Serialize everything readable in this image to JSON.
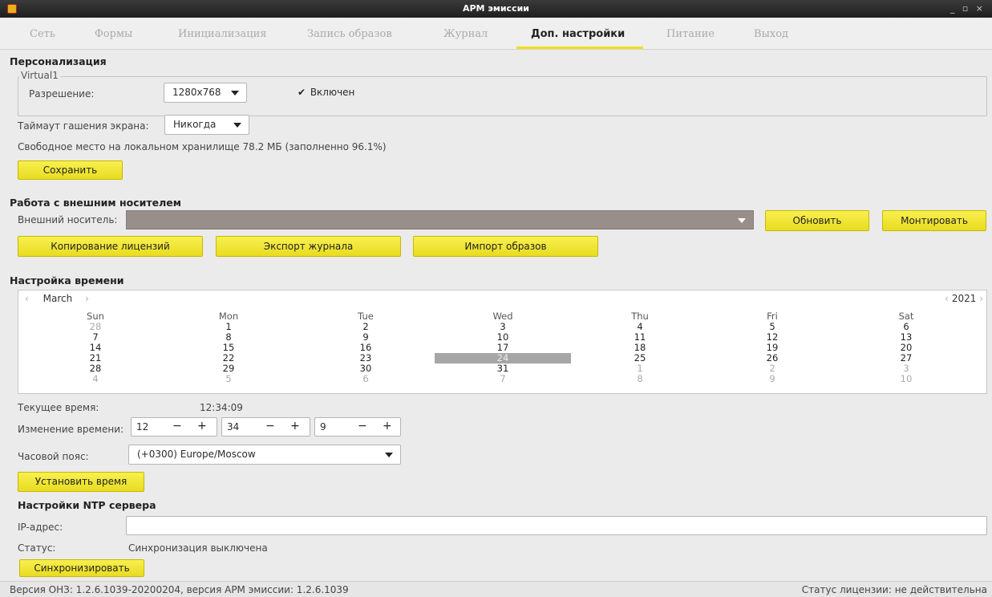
{
  "window": {
    "title": "АРМ эмиссии",
    "controls": "_ ▫ ×"
  },
  "tabs": [
    {
      "label": "Сеть"
    },
    {
      "label": "Формы"
    },
    {
      "label": "Инициализация"
    },
    {
      "label": "Запись образов"
    },
    {
      "label": "Журнал"
    },
    {
      "label": "Доп. настройки"
    },
    {
      "label": "Питание"
    },
    {
      "label": "Выход"
    }
  ],
  "personalization": {
    "heading": "Персонализация",
    "group_title": "Virtual1",
    "resolution_label": "Разрешение:",
    "resolution_value": "1280x768",
    "enabled_label": "Включен",
    "enabled_checked": true,
    "timeout_label": "Таймаут гашения экрана:",
    "timeout_value": "Никогда",
    "storage_text": "Свободное место на локальном хранилище 78.2 МБ (заполненно 96.1%)",
    "save_label": "Сохранить"
  },
  "external_media": {
    "heading": "Работа с внешним носителем",
    "media_label": "Внешний носитель:",
    "media_value": "",
    "refresh_label": "Обновить",
    "mount_label": "Монтировать",
    "copy_licenses_label": "Копирование лицензий",
    "export_log_label": "Экспорт журнала",
    "import_images_label": "Импорт образов"
  },
  "time_settings": {
    "heading": "Настройка времени",
    "calendar": {
      "month": "March",
      "year": "2021",
      "prev_month": "‹",
      "next_month": "›",
      "prev_year": "‹",
      "next_year": "›",
      "weekdays": [
        "Sun",
        "Mon",
        "Tue",
        "Wed",
        "Thu",
        "Fri",
        "Sat"
      ],
      "weeks": [
        [
          {
            "d": "28",
            "o": true
          },
          {
            "d": "1"
          },
          {
            "d": "2"
          },
          {
            "d": "3"
          },
          {
            "d": "4"
          },
          {
            "d": "5"
          },
          {
            "d": "6"
          }
        ],
        [
          {
            "d": "7"
          },
          {
            "d": "8"
          },
          {
            "d": "9"
          },
          {
            "d": "10"
          },
          {
            "d": "11"
          },
          {
            "d": "12"
          },
          {
            "d": "13"
          }
        ],
        [
          {
            "d": "14"
          },
          {
            "d": "15"
          },
          {
            "d": "16"
          },
          {
            "d": "17"
          },
          {
            "d": "18"
          },
          {
            "d": "19"
          },
          {
            "d": "20"
          }
        ],
        [
          {
            "d": "21"
          },
          {
            "d": "22"
          },
          {
            "d": "23"
          },
          {
            "d": "24",
            "s": true
          },
          {
            "d": "25"
          },
          {
            "d": "26"
          },
          {
            "d": "27"
          }
        ],
        [
          {
            "d": "28"
          },
          {
            "d": "29"
          },
          {
            "d": "30"
          },
          {
            "d": "31"
          },
          {
            "d": "1",
            "o": true
          },
          {
            "d": "2",
            "o": true
          },
          {
            "d": "3",
            "o": true
          }
        ],
        [
          {
            "d": "4",
            "o": true
          },
          {
            "d": "5",
            "o": true
          },
          {
            "d": "6",
            "o": true
          },
          {
            "d": "7",
            "o": true
          },
          {
            "d": "8",
            "o": true
          },
          {
            "d": "9",
            "o": true
          },
          {
            "d": "10",
            "o": true
          }
        ]
      ]
    },
    "current_time_label": "Текущее время:",
    "current_time_value": "12:34:09",
    "change_time_label": "Изменение времени:",
    "hours": "12",
    "minutes": "34",
    "seconds": "9",
    "minus": "−",
    "plus": "+",
    "timezone_label": "Часовой пояс:",
    "timezone_value": "(+0300) Europe/Moscow",
    "set_time_label": "Установить время"
  },
  "ntp": {
    "heading": "Настройки NTP сервера",
    "ip_label": "IP-адрес:",
    "ip_value": "",
    "status_label": "Статус:",
    "status_value": "Синхронизация выключена",
    "sync_label": "Синхронизировать"
  },
  "statusbar": {
    "version_text": "Версия ОНЗ: 1.2.6.1039-20200204, версия АРМ эмиссии: 1.2.6.1039",
    "license_text": "Статус лицензии: не действительна"
  }
}
